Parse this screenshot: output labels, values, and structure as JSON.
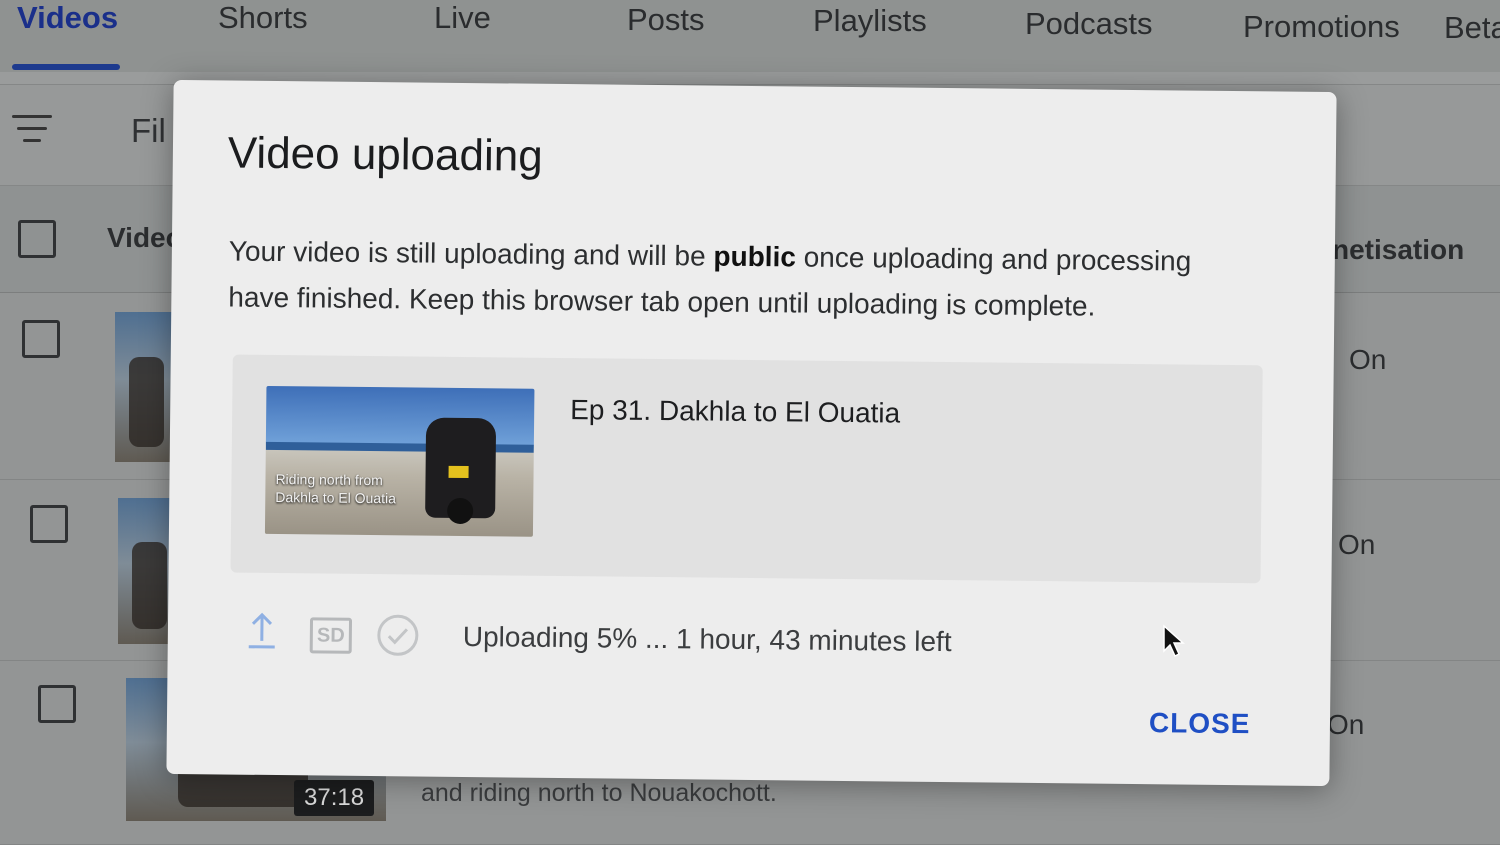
{
  "tabs": [
    "Videos",
    "Shorts",
    "Live",
    "Posts",
    "Playlists",
    "Podcasts",
    "Promotions",
    "Beta"
  ],
  "filter": {
    "label": "Fil"
  },
  "table": {
    "video_header": "Video",
    "monetisation_header": "netisation",
    "rows": [
      {
        "monetisation": "On"
      },
      {
        "monetisation": "On"
      },
      {
        "monetisation": "On",
        "duration": "37:18",
        "description": "and riding north to Nouakochott."
      }
    ]
  },
  "dialog": {
    "title": "Video uploading",
    "message_pre": "Your video is still uploading and will be ",
    "message_bold": "public",
    "message_post": " once uploading and processing have finished. Keep this browser tab open until uploading is complete.",
    "video": {
      "title": "Ep 31. Dakhla to El Ouatia",
      "thumbnail_caption": "Riding north from Dakhla to El Ouatia"
    },
    "status": {
      "text": "Uploading 5% ... 1 hour, 43 minutes left",
      "progress_percent": 5,
      "sd_label": "SD"
    },
    "close_label": "CLOSE"
  },
  "colors": {
    "accent": "#1f4fc4",
    "tab_active": "#1a2f8a",
    "dialog_bg": "#ededed"
  }
}
